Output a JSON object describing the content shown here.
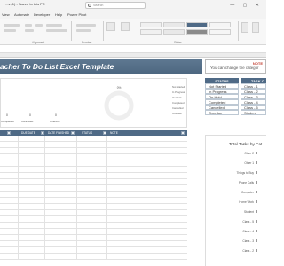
{
  "window": {
    "title": "...s (1) - Saved to this PC ~",
    "search_placeholder": "Search",
    "controls": "— ▢ ✕"
  },
  "menu": [
    "View",
    "Automate",
    "Developer",
    "Help",
    "Power Pivot"
  ],
  "ribbon": {
    "groups": [
      "Alignment",
      "Number",
      "Styles"
    ],
    "styles": [
      "Conditional Formatting",
      "Format as Table"
    ]
  },
  "sheet": {
    "title": "acher To Do List Excel Template",
    "note_title": "NOTE",
    "note_text": "You can change the categor"
  },
  "chart_data": [
    {
      "type": "pie",
      "title": "0%",
      "legend": [
        "Not Started",
        "In Progress",
        "On Hold",
        "Completed",
        "Cancelled",
        "Overdue"
      ],
      "counts": [
        {
          "value": "0",
          "label": "Completed"
        },
        {
          "value": "0",
          "label": "Cancelled"
        },
        {
          "value": "0",
          "label": "Overdue"
        }
      ]
    },
    {
      "type": "bar",
      "title": "Total Tasks by Cat",
      "categories": [
        "Other 2",
        "Other 1",
        "Things to Buy",
        "Phone Calls",
        "Computer",
        "Home Work",
        "Student",
        "Class - 5",
        "Class - 4",
        "Class - 3",
        "Class - 2"
      ],
      "values": [
        0,
        0,
        0,
        0,
        0,
        0,
        0,
        0,
        0,
        0,
        0
      ]
    }
  ],
  "task_table": {
    "headers": [
      "",
      "DUE DATE",
      "DATE FINISHED",
      "STATUS",
      "NOTE"
    ]
  },
  "status_table": {
    "header": "STATUS",
    "items": [
      "Not Started",
      "In Progress",
      "On Hold",
      "Completed",
      "Cancelled",
      "Overdue"
    ]
  },
  "category_table": {
    "header": "TASK C",
    "items": [
      "Class - 1",
      "Class - 2",
      "Class - 3",
      "Class - 4",
      "Class - 5",
      "Student"
    ]
  },
  "colors": {
    "header_blue": "#4f6a86",
    "banner": "#5e7891",
    "note_red": "#c0392b"
  }
}
